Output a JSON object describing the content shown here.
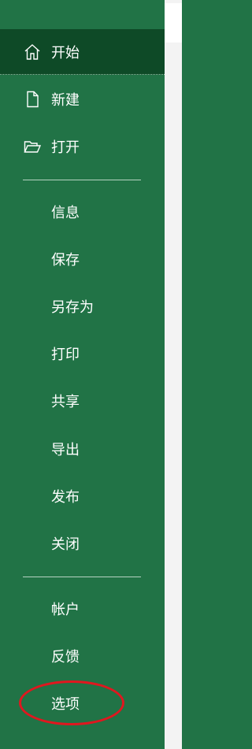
{
  "backstage": {
    "primary_items": [
      {
        "label": "开始",
        "icon": "home-icon"
      },
      {
        "label": "新建",
        "icon": "new-document-icon"
      },
      {
        "label": "打开",
        "icon": "open-folder-icon"
      }
    ],
    "info_items": [
      {
        "label": "信息"
      },
      {
        "label": "保存"
      },
      {
        "label": "另存为"
      },
      {
        "label": "打印"
      },
      {
        "label": "共享"
      },
      {
        "label": "导出"
      },
      {
        "label": "发布"
      },
      {
        "label": "关闭"
      }
    ],
    "footer_items": [
      {
        "label": "帐户"
      },
      {
        "label": "反馈"
      },
      {
        "label": "选项"
      }
    ]
  },
  "colors": {
    "sidebar_bg": "#217346",
    "selected_bg": "#0e4a27",
    "text": "#ffffff",
    "annotation": "#e0171f"
  }
}
